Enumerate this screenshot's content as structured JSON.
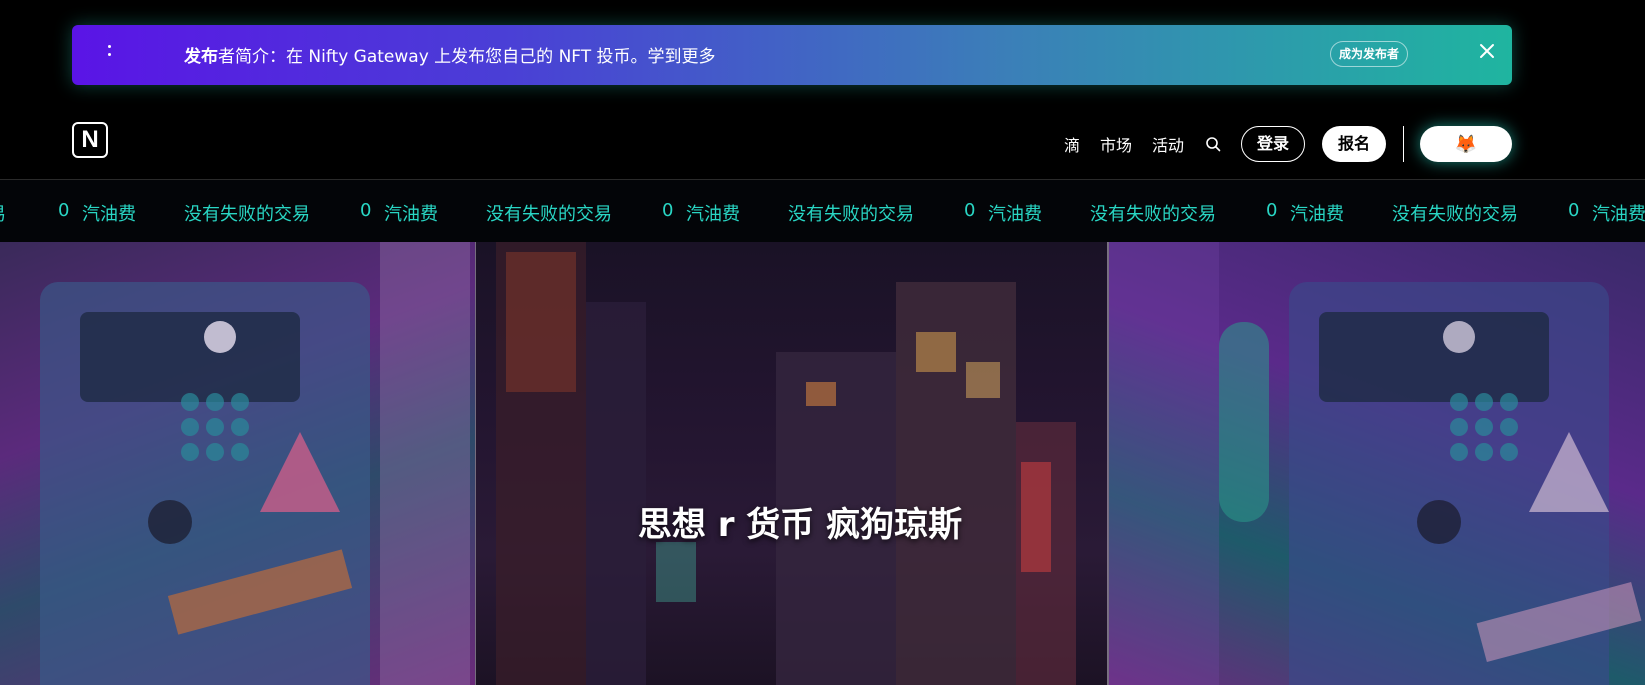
{
  "banner": {
    "message_bold": "发布",
    "message_rest": "者简介：在 Nifty Gateway 上发布您自己的 NFT 投币。学到更多",
    "cta_label": "成为发布者",
    "close_icon": "close-icon"
  },
  "header": {
    "logo_text": "N",
    "nav": [
      "滴",
      "市场",
      "活动"
    ],
    "search_icon": "search-icon",
    "login_label": "登录",
    "signup_label": "报名",
    "wallet_icon": "🦊"
  },
  "ticker": {
    "items": [
      "易",
      "0",
      "汽油费",
      "没有失败的交易",
      "0",
      "汽油费",
      "没有失败的交易",
      "0",
      "汽油费",
      "没有失败的交易",
      "0",
      "汽油费",
      "没有失败的交易",
      "0",
      "汽油费",
      "没有失败的交易",
      "0",
      "汽油费"
    ],
    "color": "#29d6c4"
  },
  "hero": {
    "title": "思想 r 货币 疯狗琼斯"
  },
  "colors": {
    "banner_start": "#5a14e6",
    "banner_end": "#1fb5a0",
    "accent": "#29d6c4"
  }
}
